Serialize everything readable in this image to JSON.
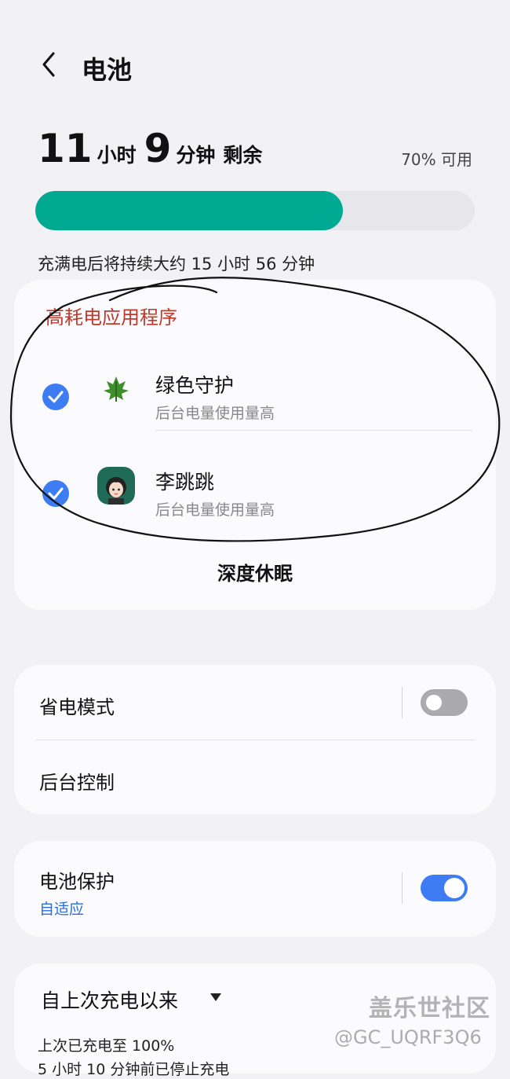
{
  "header": {
    "title": "电池"
  },
  "summary": {
    "hours": "11",
    "hours_unit": "小时",
    "minutes": "9",
    "minutes_unit": "分钟",
    "remaining": "剩余",
    "available": "70% 可用",
    "level": 0.7,
    "full_estimate": "充满电后将持续大约 15 小时 56 分钟"
  },
  "high_usage": {
    "title": "高耗电应用程序",
    "apps": [
      {
        "name": "绿色守护",
        "sub": "后台电量使用量高",
        "checked": true,
        "icon": "leaf-icon"
      },
      {
        "name": "李跳跳",
        "sub": "后台电量使用量高",
        "checked": true,
        "icon": "girl-avatar-icon"
      }
    ],
    "action": "深度休眠"
  },
  "settings": {
    "power_saving": "省电模式",
    "power_saving_on": false,
    "background_limits": "后台控制"
  },
  "protection": {
    "label": "电池保护",
    "mode": "自适应",
    "on": true
  },
  "usage": {
    "since": "自上次充电以来",
    "last_charged": "上次已充电至 100%",
    "stopped": "5 小时 10 分钟前已停止充电"
  },
  "watermark": {
    "brand": "盖乐世社区",
    "user": "@GC_UQRF3Q6"
  },
  "colors": {
    "accent": "#3d7cf2",
    "bar": "#00a991",
    "warning": "#c0392b"
  }
}
